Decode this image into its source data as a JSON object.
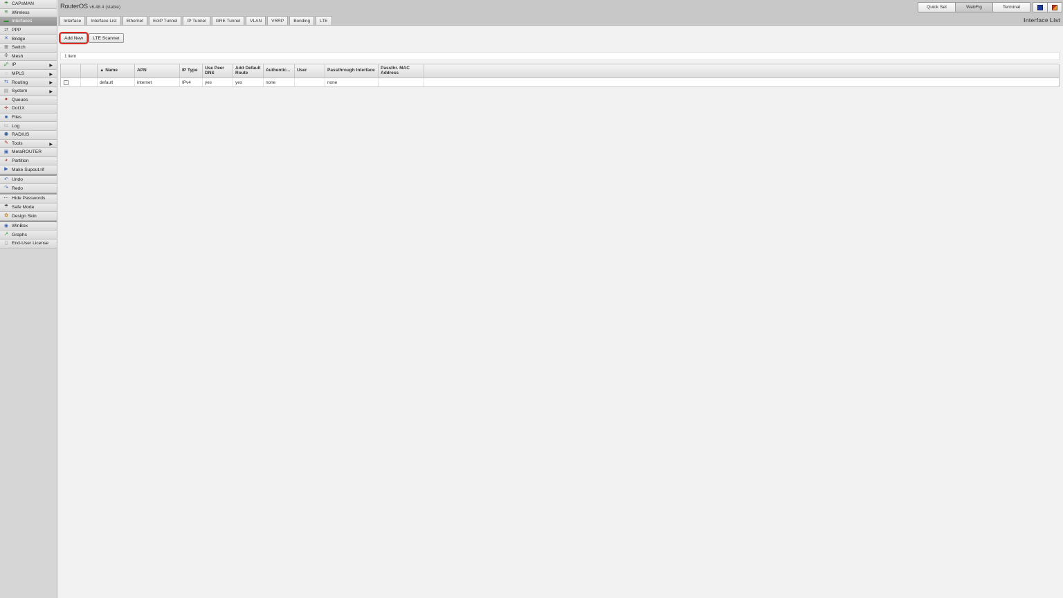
{
  "brand": {
    "name": "RouterOS",
    "version": "v6.48.4 (stable)"
  },
  "sidebar": {
    "groups": [
      [
        {
          "label": "CAPsMAN",
          "icon": "capsman-icon",
          "glyph": "☂",
          "color": "#3c8a3c"
        },
        {
          "label": "Wireless",
          "icon": "wireless-icon",
          "glyph": "≋",
          "color": "#3c8a3c"
        },
        {
          "label": "Interfaces",
          "icon": "interfaces-icon",
          "glyph": "▬",
          "color": "#2e8b2e",
          "selected": true
        },
        {
          "label": "PPP",
          "icon": "ppp-icon",
          "glyph": "⇄",
          "color": "#555"
        },
        {
          "label": "Bridge",
          "icon": "bridge-icon",
          "glyph": "✕",
          "color": "#3860b0"
        },
        {
          "label": "Switch",
          "icon": "switch-icon",
          "glyph": "⊞",
          "color": "#555"
        },
        {
          "label": "Mesh",
          "icon": "mesh-icon",
          "glyph": "✣",
          "color": "#555"
        },
        {
          "label": "IP",
          "icon": "ip-icon",
          "glyph": "☍",
          "color": "#3c8a3c",
          "arrow": true
        },
        {
          "label": "MPLS",
          "icon": "mpls-icon",
          "glyph": "◌",
          "color": "#888",
          "arrow": true
        },
        {
          "label": "Routing",
          "icon": "routing-icon",
          "glyph": "⇆",
          "color": "#3860b0",
          "arrow": true
        },
        {
          "label": "System",
          "icon": "system-icon",
          "glyph": "▤",
          "color": "#888",
          "arrow": true
        },
        {
          "label": "Queues",
          "icon": "queues-icon",
          "glyph": "●",
          "color": "#b03020"
        },
        {
          "label": "Dot1X",
          "icon": "dot1x-icon",
          "glyph": "✛",
          "color": "#b03020"
        },
        {
          "label": "Files",
          "icon": "files-icon",
          "glyph": "■",
          "color": "#3860b0"
        },
        {
          "label": "Log",
          "icon": "log-icon",
          "glyph": "▭",
          "color": "#888"
        },
        {
          "label": "RADIUS",
          "icon": "radius-icon",
          "glyph": "⚉",
          "color": "#3c6aa0"
        },
        {
          "label": "Tools",
          "icon": "tools-icon",
          "glyph": "✎",
          "color": "#b03020",
          "arrow": true
        },
        {
          "label": "MetaROUTER",
          "icon": "metarouter-icon",
          "glyph": "▣",
          "color": "#3860b0"
        },
        {
          "label": "Partition",
          "icon": "partition-icon",
          "glyph": "◕",
          "color": "#c04020"
        },
        {
          "label": "Make Supout.rif",
          "icon": "supout-icon",
          "glyph": "▶",
          "color": "#3860b0"
        }
      ],
      [
        {
          "label": "Undo",
          "icon": "undo-icon",
          "glyph": "↶",
          "color": "#3860b0"
        },
        {
          "label": "Redo",
          "icon": "redo-icon",
          "glyph": "↷",
          "color": "#3860b0"
        }
      ],
      [
        {
          "label": "Hide Passwords",
          "icon": "hide-passwords-icon",
          "glyph": "⋯",
          "color": "#333"
        },
        {
          "label": "Safe Mode",
          "icon": "safe-mode-icon",
          "glyph": "☂",
          "color": "#333"
        },
        {
          "label": "Design Skin",
          "icon": "design-skin-icon",
          "glyph": "✿",
          "color": "#c08020"
        }
      ],
      [
        {
          "label": "WinBox",
          "icon": "winbox-icon",
          "glyph": "◉",
          "color": "#3860b0"
        },
        {
          "label": "Graphs",
          "icon": "graphs-icon",
          "glyph": "↗",
          "color": "#2e8b2e"
        },
        {
          "label": "End-User License",
          "icon": "license-icon",
          "glyph": "▯",
          "color": "#888"
        }
      ]
    ]
  },
  "tabs": [
    "Interface",
    "Interface List",
    "Ethernet",
    "EoIP Tunnel",
    "IP Tunnel",
    "GRE Tunnel",
    "VLAN",
    "VRRP",
    "Bonding",
    "LTE"
  ],
  "modes": {
    "quick_set": "Quick Set",
    "webfig": "WebFig",
    "terminal": "Terminal"
  },
  "page_title": "Interface List",
  "toolbar": {
    "add_new": "Add New",
    "lte_scanner": "LTE Scanner"
  },
  "count": "1 item",
  "table": {
    "columns": [
      "",
      "",
      "▲ Name",
      "APN",
      "IP Type",
      "Use Peer DNS",
      "Add Default Route",
      "Authentic...",
      "User",
      "Passthrough Interface",
      "Passthr. MAC Address"
    ],
    "rows": [
      {
        "expander": "-",
        "flag": "",
        "name": "default",
        "apn": "internet",
        "ip_type": "IPv4",
        "use_peer_dns": "yes",
        "add_default_route": "yes",
        "authentication": "none",
        "user": "",
        "passthrough_interface": "none",
        "passthrough_mac": ""
      }
    ]
  },
  "colors": {
    "highlight": "#e0281e",
    "selected_menu": "#9c9c9c"
  }
}
